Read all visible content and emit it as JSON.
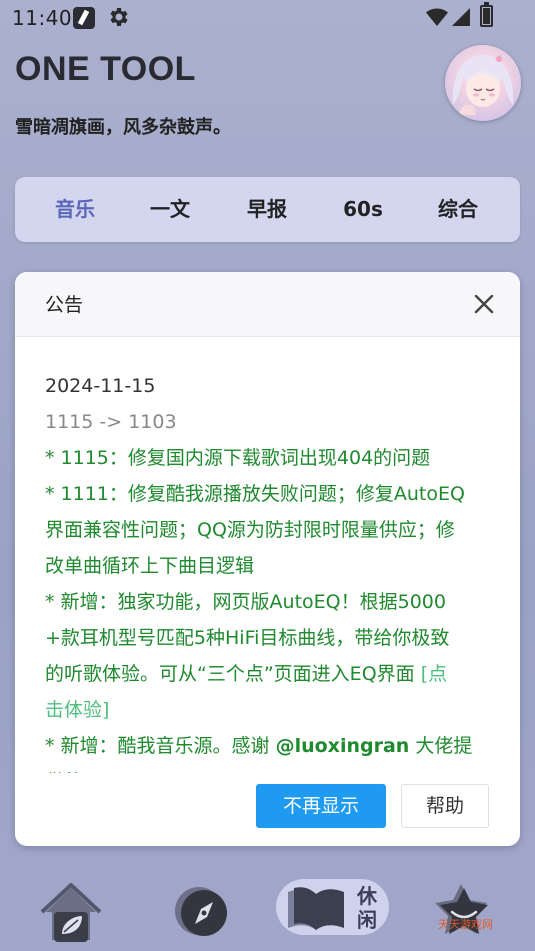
{
  "status_bar": {
    "time": "11:40",
    "icons": [
      "app-pencil-icon",
      "gear-icon",
      "wifi-icon",
      "signal-icon",
      "battery-icon"
    ]
  },
  "header": {
    "title": "ONE TOOL",
    "subtitle": "雪暗凋旗画，风多杂鼓声。",
    "avatar": "anime-avatar"
  },
  "tabs": [
    {
      "label": "音乐",
      "active": true
    },
    {
      "label": "一文",
      "active": false
    },
    {
      "label": "早报",
      "active": false
    },
    {
      "label": "60s",
      "active": false
    },
    {
      "label": "综合",
      "active": false
    }
  ],
  "dialog": {
    "title": "公告",
    "date": "2024-11-15",
    "version": "1115 -> 1103",
    "lines": [
      "* 1115：修复国内源下载歌词出现404的问题",
      "* 1111：修复酷我源播放失败问题；修复AutoEQ",
      "界面兼容性问题；QQ源为防封限时限量供应；修",
      "改单曲循环上下曲目逻辑",
      "* 新增：独家功能，网页版AutoEQ！根据5000",
      "+款耳机型号匹配5种HiFi目标曲线，带给你极致",
      "的听歌体验。可从“三个点”页面进入EQ界面 "
    ],
    "link_part1": "[点",
    "link_part2": "击体验]",
    "line_new2_prefix": "* 新增：酷我音乐源。感谢 ",
    "mention": "@luoxingran",
    "line_new2_suffix": " 大佬提",
    "last_partial": "供的API",
    "primary_button": "不再显示",
    "help_button": "帮助"
  },
  "bottom_nav": {
    "items": [
      "home-icon",
      "compass-icon",
      "book-icon",
      "star-icon"
    ],
    "active_label": "休闲"
  },
  "watermark": "天天游戏网",
  "colors": {
    "accent_blue": "#1e9bf0",
    "tab_active": "#5a67b8",
    "changelog_green": "#1f8a2e",
    "link_green": "#4fbf7f"
  }
}
